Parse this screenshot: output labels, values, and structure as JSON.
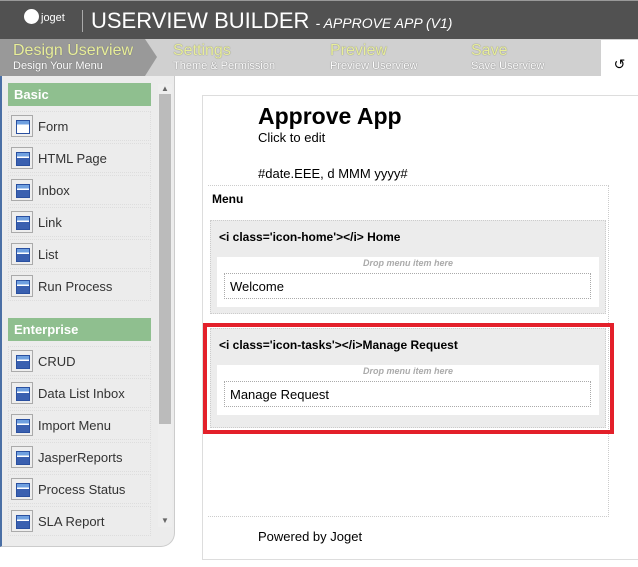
{
  "header": {
    "logo_text": "joget",
    "title": "USERVIEW BUILDER",
    "subtitle": "- APPROVE APP (V1)"
  },
  "steps": [
    {
      "name": "Design Userview",
      "sub": "Design Your Menu"
    },
    {
      "name": "Settings",
      "sub": "Theme & Permission"
    },
    {
      "name": "Preview",
      "sub": "Preview Userview"
    },
    {
      "name": "Save",
      "sub": "Save Userview"
    }
  ],
  "undo_icon": "↺",
  "sidebar": {
    "basic_label": "Basic",
    "basic": [
      "Form",
      "HTML Page",
      "Inbox",
      "Link",
      "List",
      "Run Process"
    ],
    "enterprise_label": "Enterprise",
    "enterprise": [
      "CRUD",
      "Data List Inbox",
      "Import Menu",
      "JasperReports",
      "Process Status",
      "SLA Report"
    ]
  },
  "canvas": {
    "app_title": "Approve App",
    "click_to_edit": "Click to edit",
    "date": "#date.EEE, d MMM yyyy#",
    "menu_label": "Menu",
    "categories": [
      {
        "label": "<i class='icon-home'></i> Home",
        "drop": "Drop menu item here",
        "item": "Welcome"
      },
      {
        "label": "<i class='icon-tasks'></i>Manage Request",
        "drop": "Drop menu item here",
        "item": "Manage Request"
      }
    ],
    "footer": "Powered by Joget"
  },
  "highlight_color": "#e3202a"
}
